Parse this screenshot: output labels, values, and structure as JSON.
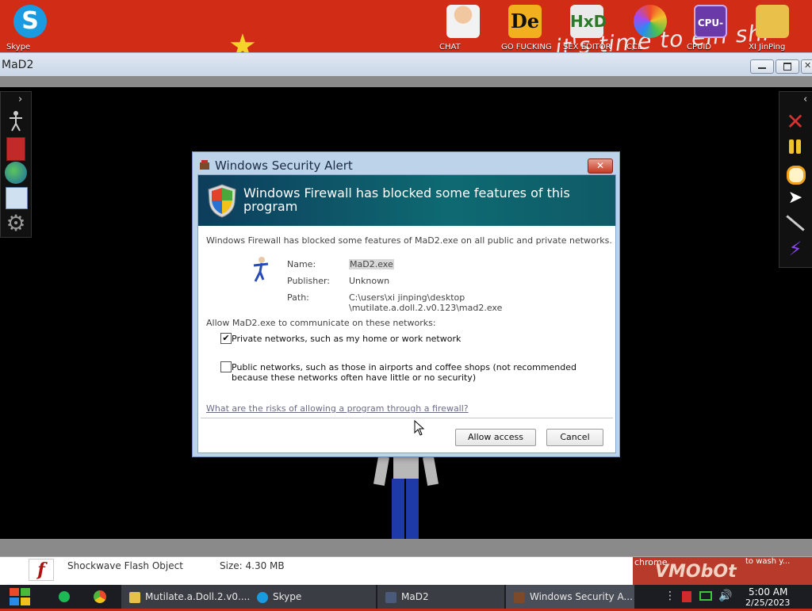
{
  "desktop": {
    "icons": [
      {
        "label": "Skype",
        "icon": "skype-icon",
        "color": "#1a9ae0"
      },
      {
        "label": "CHAT",
        "icon": "doctor-avatar-icon",
        "color": "#f2f2f2"
      },
      {
        "label": "GO FUCKING",
        "icon": "de-icon",
        "color": "#f2b01e"
      },
      {
        "label": "SEX EDITOR",
        "icon": "hxd-hex-editor-icon",
        "color": "#eaeaea"
      },
      {
        "label": "CCL",
        "icon": "color-wheel-icon",
        "color": "#f26a2a"
      },
      {
        "label": "CPUID",
        "icon": "cpu-z-icon",
        "color": "#6a3aa8"
      },
      {
        "label": "XI JinPing",
        "icon": "folder-user-icon",
        "color": "#e8c04a"
      }
    ],
    "wallpaper_text": "it's time to ein shi"
  },
  "mad2_window": {
    "title": "MaD2",
    "controls": [
      "minimize-icon",
      "maximize-icon",
      "close-icon"
    ],
    "left_tools": [
      "person-pose-icon",
      "book-icon",
      "globe-icon",
      "save-disk-icon",
      "gear-icon"
    ],
    "right_tools": [
      "red-x-icon",
      "pause-icon",
      "stopwatch-icon",
      "cursor-icon",
      "knife-icon",
      "lightning-icon"
    ]
  },
  "dialog": {
    "title": "Windows Security Alert",
    "banner": "Windows Firewall has blocked some features of this program",
    "summary": "Windows Firewall has blocked some features of MaD2.exe on all public and private networks.",
    "name_label": "Name:",
    "name_value": "MaD2.exe",
    "publisher_label": "Publisher:",
    "publisher_value": "Unknown",
    "path_label": "Path:",
    "path_line1": "C:\\users\\xi jinping\\desktop",
    "path_line2": "\\mutilate.a.doll.2.v0.123\\mad2.exe",
    "allow_prompt": "Allow MaD2.exe to communicate on these networks:",
    "private_label": "Private networks, such as my home or work network",
    "private_checked": true,
    "public_line1": "Public networks, such as those in airports and coffee shops (not recommended",
    "public_line2": "because these networks often have little or no security)",
    "public_checked": false,
    "risk_link": "What are the risks of allowing a program through a firewall?",
    "allow_button": "Allow access",
    "cancel_button": "Cancel"
  },
  "download_bar": {
    "file_name": "Shockwave Flash Object",
    "size": "Size:  4.30 MB",
    "chrome_label": "chrome",
    "wash_text": "to wash y...",
    "banner_text": "VMObOt"
  },
  "taskbar": {
    "items": [
      {
        "label": "Mutilate.a.Doll.2.v0....",
        "icon": "folder-icon"
      },
      {
        "label": "Skype",
        "icon": "skype-icon"
      },
      {
        "label": "MaD2",
        "icon": "mad2-icon"
      },
      {
        "label": "Windows Security A...",
        "icon": "security-alert-icon"
      }
    ],
    "time": "5:00 AM",
    "date": "2/25/2023"
  }
}
